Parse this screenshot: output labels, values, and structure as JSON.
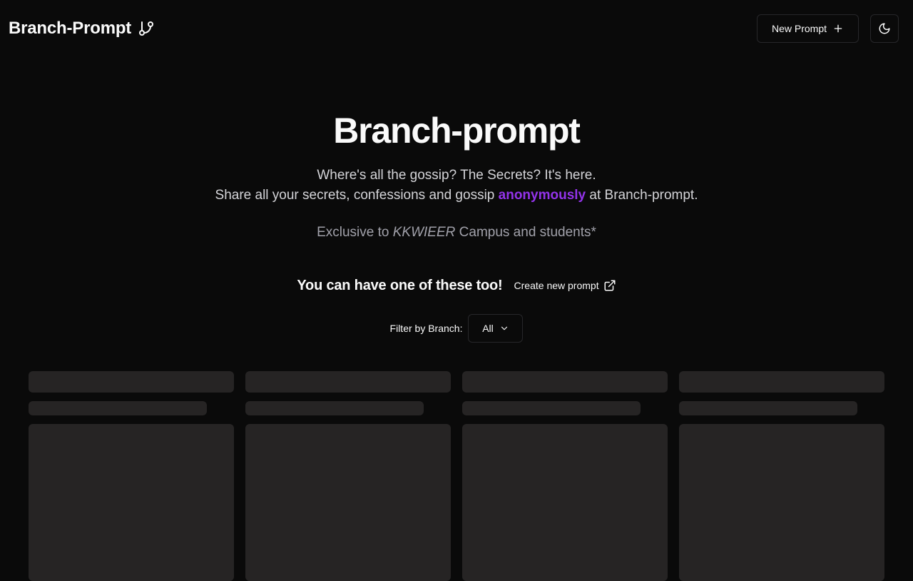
{
  "header": {
    "brand": "Branch-Prompt",
    "brand_icon": "git-branch-icon",
    "new_prompt_label": "New Prompt",
    "new_prompt_icon": "plus-icon",
    "theme_icon": "moon-icon"
  },
  "hero": {
    "title": "Branch-prompt",
    "line1": "Where's all the gossip? The Secrets? It's here.",
    "line2_before": "Share all your secrets, confessions and gossip ",
    "line2_accent": "anonymously",
    "line2_after": " at Branch-prompt.",
    "line3_before": "Exclusive to ",
    "line3_campus": "KKWIEER",
    "line3_after": " Campus and students*"
  },
  "cta": {
    "text": "You can have one of these too!",
    "link_label": "Create new prompt",
    "link_icon": "external-link-icon"
  },
  "filter": {
    "label": "Filter by Branch:",
    "selected": "All",
    "icon": "chevron-down-icon"
  },
  "colors": {
    "background": "#0a0a0a",
    "accent": "#9333ea",
    "skeleton": "#262424",
    "border": "#27272a"
  },
  "cards_loading": 4
}
